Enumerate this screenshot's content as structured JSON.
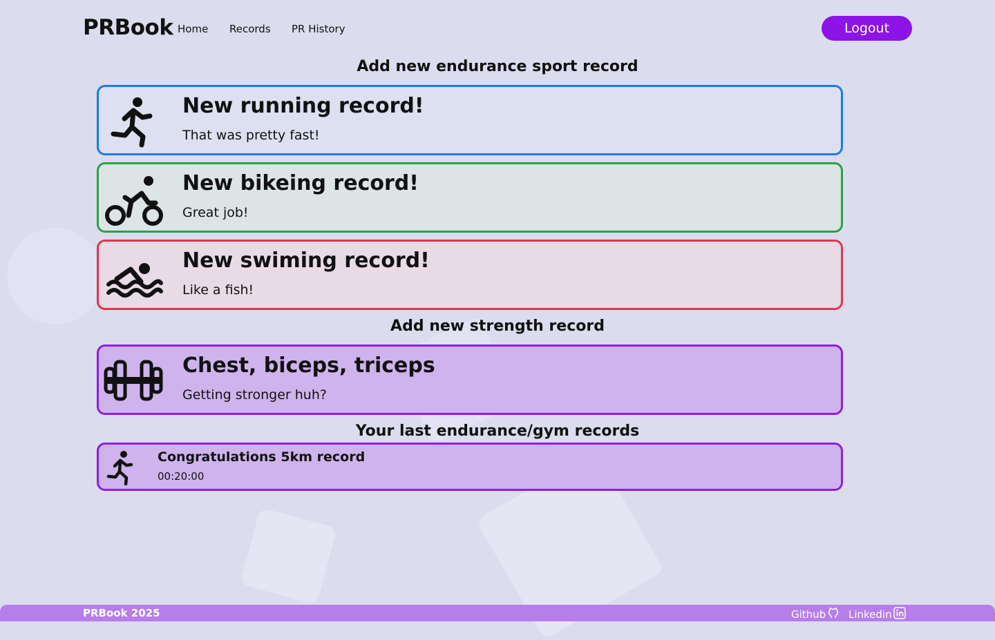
{
  "header": {
    "brand": "PRBook",
    "nav": [
      "Home",
      "Records",
      "PR History"
    ],
    "logout_label": "Logout"
  },
  "sections": {
    "endurance_title": "Add new endurance sport record",
    "strength_title": "Add new strength record",
    "last_title": "Your last endurance/gym records"
  },
  "cards": {
    "running": {
      "title": "New running record!",
      "subtitle": "That was pretty fast!",
      "icon": "running-icon",
      "color": "#1a7ae6"
    },
    "biking": {
      "title": "New bikeing record!",
      "subtitle": "Great job!",
      "icon": "biking-icon",
      "color": "#2aa142"
    },
    "swimming": {
      "title": "New swiming record!",
      "subtitle": "Like a fish!",
      "icon": "swimming-icon",
      "color": "#e0354e"
    },
    "strength": {
      "title": "Chest, biceps, triceps",
      "subtitle": "Getting stronger huh?",
      "icon": "dumbbell-icon",
      "color": "#8c1de6"
    }
  },
  "last_record": {
    "title": "Congratulations 5km record",
    "value": "00:20:00",
    "icon": "running-icon"
  },
  "footer": {
    "brand": "PRBook 2025",
    "github": "Github",
    "linkedin": "Linkedin"
  },
  "colors": {
    "accent": "#8c14e6",
    "background": "#dcdcef",
    "footer": "#b77de9"
  }
}
